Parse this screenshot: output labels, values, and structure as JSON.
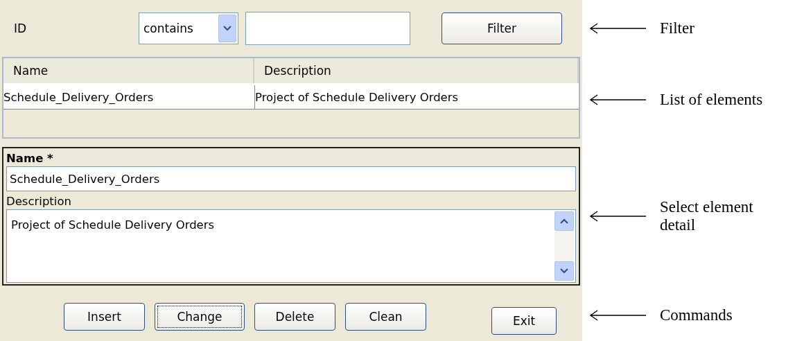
{
  "filter": {
    "field_label": "ID",
    "operator": "contains",
    "button": "Filter"
  },
  "list": {
    "columns": [
      "Name",
      "Description"
    ],
    "rows": [
      {
        "cells": [
          "Schedule_Delivery_Orders",
          "Project of Schedule Delivery Orders"
        ]
      }
    ]
  },
  "detail": {
    "name_label": "Name *",
    "name_value": "Schedule_Delivery_Orders",
    "description_label": "Description",
    "description_value": "Project of Schedule Delivery Orders"
  },
  "commands": [
    {
      "label": "Insert",
      "focused": false
    },
    {
      "label": "Change",
      "focused": true
    },
    {
      "label": "Delete",
      "focused": false
    },
    {
      "label": "Clean",
      "focused": false
    }
  ],
  "exit_button": "Exit",
  "annotations": [
    "Filter",
    "List of elements",
    "Select element detail",
    "Commands"
  ]
}
